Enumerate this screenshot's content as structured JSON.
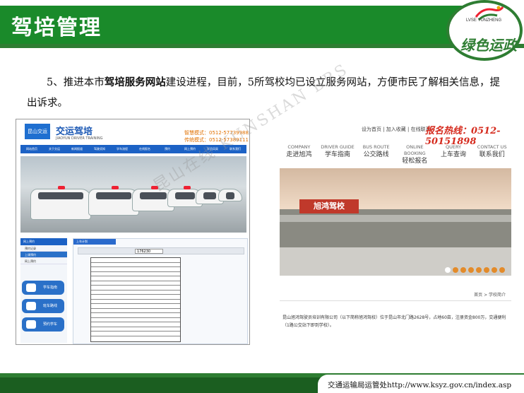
{
  "header": {
    "title": "驾培管理",
    "logo_en": "LVSE YUNZHENG",
    "logo_cn": "绿色运政",
    "accent": "#1a8a2a"
  },
  "paragraph": {
    "part1": "5、推进本市",
    "bold": "驾培服务网站",
    "part2": "建设进程，目前，5所驾校均已设立服务网站，方便市民了解相关信息，提出诉求。"
  },
  "left_site": {
    "logo": "昆山交运",
    "brand": "交运驾培",
    "brand_en": "JIAOYUN DRIVER TRAINING",
    "phone1": "智慧模式：0512-57739988",
    "phone2": "传统模式：0512-57389111",
    "nav": [
      "网站首页",
      "关于交运",
      "新闻报道",
      "驾驶须知",
      "学车流程",
      "在线报名",
      "预约",
      "网上预约",
      "学员风采",
      "联系我们"
    ],
    "side_header": "网上预约",
    "side_items": [
      "预约记录",
      "上课预约",
      "网上预约"
    ],
    "buttons": [
      "学车指南",
      "班车路线",
      "预约学车"
    ],
    "main_header": "上车计划",
    "search_value": "176230"
  },
  "right_site": {
    "top_links": "设为首页 | 加入收藏 | 在线联系",
    "hotline": "报名热线：0512-50151898",
    "nav": [
      {
        "en": "COMPANY",
        "cn": "走进旭鸿"
      },
      {
        "en": "DRIVER GUIDE",
        "cn": "学车指南"
      },
      {
        "en": "BUS ROUTE",
        "cn": "公交路线"
      },
      {
        "en": "ONLINE BOOKING",
        "cn": "轻松报名"
      },
      {
        "en": "QUERY",
        "cn": "上车查询"
      },
      {
        "en": "CONTACT US",
        "cn": "联系我们"
      }
    ],
    "school_sign": "旭鸿驾校",
    "breadcrumb": "首页 > 学校简介",
    "body": "昆山旭鸿驾驶员培训有限公司（以下简称旭鸿驾校）位于昆山市北门路2628号，占地60亩，注册资金800万，交通便利（1路公交站下即到学校）。"
  },
  "watermark": "昆山在线 KUNSHAN BBS",
  "footer": {
    "text": "交通运输局运管处http://www.ksyz.gov.cn/index.asp",
    "color": "#2e7d32"
  }
}
